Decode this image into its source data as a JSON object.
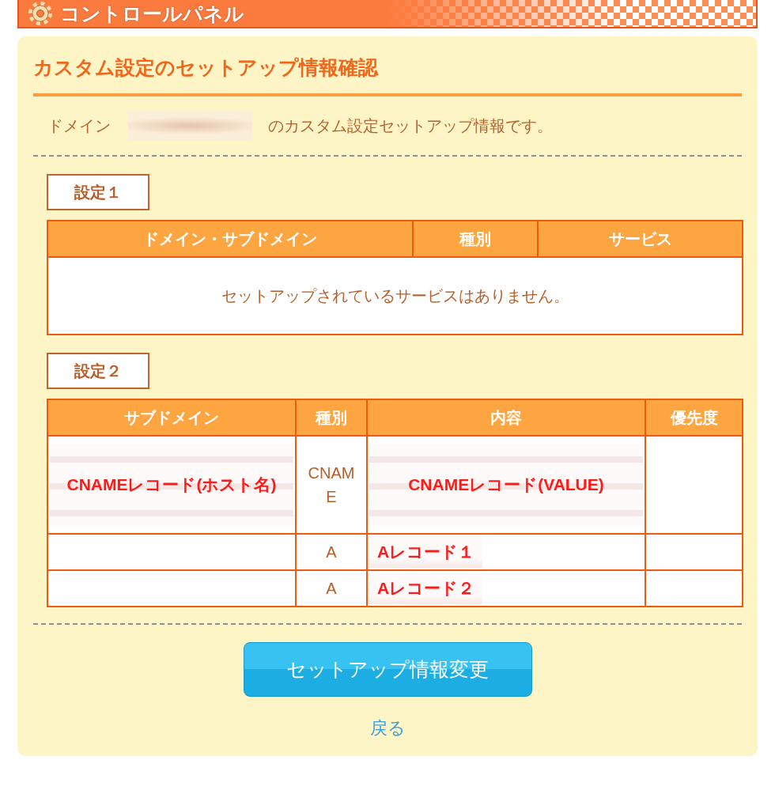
{
  "header": {
    "title": "コントロールパネル"
  },
  "page": {
    "title": "カスタム設定のセットアップ情報確認",
    "intro": {
      "label": "ドメイン",
      "domain_redacted": true,
      "suffix": "のカスタム設定セットアップ情報です。"
    }
  },
  "sections": [
    {
      "kind": "empty_table",
      "label": "設定１",
      "columns": [
        "ドメイン・サブドメイン",
        "種別",
        "サービス"
      ],
      "empty_message": "セットアップされているサービスはありません。"
    },
    {
      "kind": "record_table",
      "label": "設定２",
      "columns": [
        "サブドメイン",
        "種別",
        "内容",
        "優先度"
      ],
      "rows": [
        {
          "subdomain": {
            "redacted": true,
            "annotation": "CNAMEレコード(ホスト名)"
          },
          "type": "CNAME",
          "content": {
            "redacted": true,
            "annotation": "CNAMEレコード(VALUE)"
          }
        },
        {
          "type": "A",
          "content": {
            "redacted": true,
            "annotation": "Aレコード１"
          }
        },
        {
          "type": "A",
          "content": {
            "redacted": true,
            "annotation": "Aレコード２"
          }
        }
      ]
    }
  ],
  "actions": {
    "primary_button": "セットアップ情報変更",
    "back_link": "戻る"
  }
}
